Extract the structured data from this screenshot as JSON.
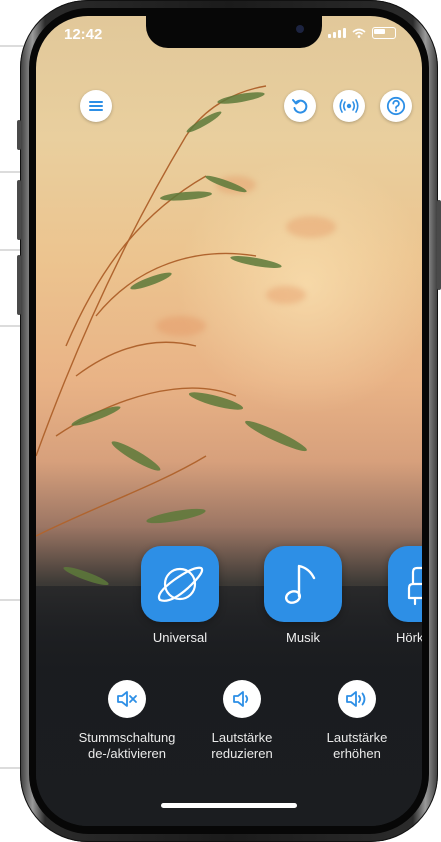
{
  "status_bar": {
    "time": "12:42"
  },
  "colors": {
    "accent": "#2d8fe6",
    "icon_blue": "#2d8fe6"
  },
  "top_buttons": [
    {
      "name": "menu-button",
      "icon": "hamburger-icon"
    },
    {
      "name": "undo-button",
      "icon": "undo-icon"
    },
    {
      "name": "broadcast-button",
      "icon": "broadcast-icon"
    },
    {
      "name": "help-button",
      "icon": "help-icon"
    }
  ],
  "modes": [
    {
      "label": "Universal",
      "icon": "planet-icon"
    },
    {
      "label": "Musik",
      "icon": "music-note-icon"
    },
    {
      "label": "Hörko",
      "icon": "armchair-icon"
    }
  ],
  "volume": {
    "mute": {
      "line1": "Stummschaltung",
      "line2": "de-/aktivieren"
    },
    "down": {
      "line1": "Lautstärke",
      "line2": "reduzieren"
    },
    "up": {
      "line1": "Lautstärke",
      "line2": "erhöhen"
    }
  }
}
